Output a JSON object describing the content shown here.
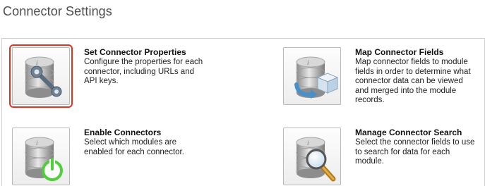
{
  "page": {
    "title": "Connector Settings"
  },
  "tiles": [
    {
      "title": "Set Connector Properties",
      "description": "Configure the properties for each connector, including URLs and API keys.",
      "icon": "database-wrench-icon",
      "selected": true
    },
    {
      "title": "Map Connector Fields",
      "description": "Map connector fields to module fields in order to determine what connector data can be viewed and merged into the module records.",
      "icon": "database-cube-icon",
      "selected": false
    },
    {
      "title": "Enable Connectors",
      "description": "Select which modules are enabled for each connector.",
      "icon": "database-power-icon",
      "selected": false
    },
    {
      "title": "Manage Connector Search",
      "description": "Select the connector fields to use to search for data for each module.",
      "icon": "database-search-icon",
      "selected": false
    }
  ],
  "colors": {
    "selection_outline": "#e0321c",
    "power_green": "#4fcf3a",
    "cube_blue": "#4a90c8"
  }
}
